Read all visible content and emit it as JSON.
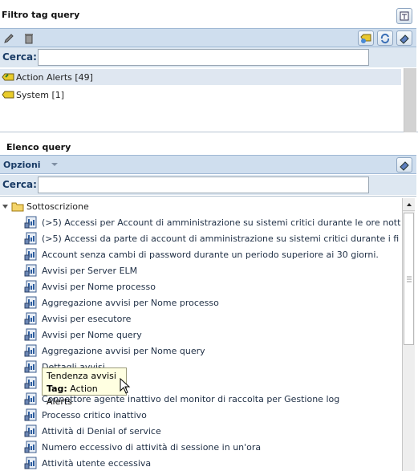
{
  "tag_panel": {
    "title": "Filtro tag query",
    "search_label": "Cerca:",
    "search_value": "",
    "tags": [
      {
        "label": "Action Alerts [49]",
        "selected": true
      },
      {
        "label": "System [1]",
        "selected": false
      }
    ]
  },
  "query_panel": {
    "title": "Elenco query",
    "options_label": "Opzioni",
    "search_label": "Cerca:",
    "search_value": "",
    "folder": "Sottoscrizione",
    "items": [
      "(>5) Accessi per Account di amministrazione su sistemi critici durante le ore nott",
      "(>5) Accessi da parte di account di amministrazione su sistemi critici durante i fi",
      "Account senza cambi di password durante un periodo superiore ai 30 giorni.",
      "Avvisi per Server ELM",
      "Avvisi per Nome processo",
      "Aggregazione avvisi per Nome processo",
      "Avvisi per esecutore",
      "Avvisi per Nome query",
      "Aggregazione avvisi per Nome query",
      "Dettagli avvisi",
      "Tendenza avvisi",
      "Connettore agente inattivo del monitor di raccolta per Gestione log",
      "Processo critico inattivo",
      "Attività di Denial of service",
      "Numero eccessivo di attività di sessione in un'ora",
      "Attività utente eccessiva"
    ]
  },
  "tooltip": {
    "title": "Tendenza avvisi",
    "tag_label": "Tag:",
    "tag_value": "Action Alerts"
  }
}
